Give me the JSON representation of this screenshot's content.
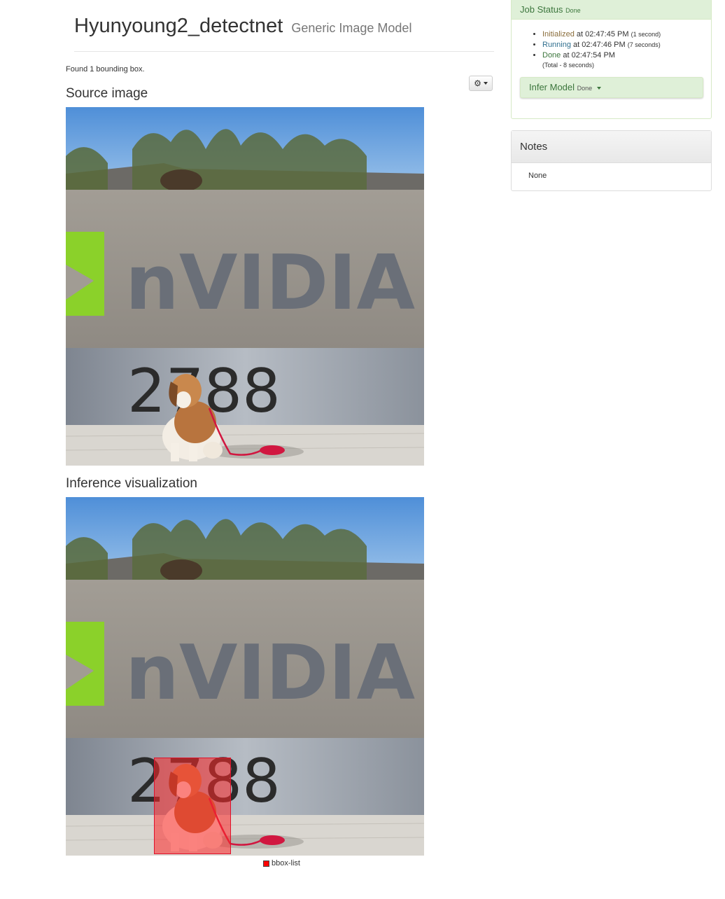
{
  "header": {
    "title": "Hyunyoung2_detectnet",
    "subtitle": "Generic Image Model"
  },
  "result_text": "Found 1 bounding box.",
  "toolbar": {
    "gear_icon": "gear-icon"
  },
  "source": {
    "title": "Source image"
  },
  "inference": {
    "title": "Inference visualization",
    "legend_label": "bbox-list",
    "legend_color": "#ff0000"
  },
  "job_status": {
    "title": "Job Status",
    "state": "Done",
    "events": [
      {
        "label": "Initialized",
        "time": "at 02:47:45 PM",
        "duration": "(1 second)"
      },
      {
        "label": "Running",
        "time": "at 02:47:46 PM",
        "duration": "(7 seconds)"
      },
      {
        "label": "Done",
        "time": "at 02:47:54 PM",
        "duration": ""
      }
    ],
    "total": "(Total - 8 seconds)",
    "infer_button": {
      "label": "Infer Model",
      "state": "Done"
    }
  },
  "notes": {
    "title": "Notes",
    "body": "None"
  },
  "photo": {
    "sign_text": "nVIDIA",
    "address": "2788"
  },
  "colors": {
    "success_bg": "#dff0d8",
    "success_text": "#3c763d",
    "bbox": "#ff0000"
  }
}
